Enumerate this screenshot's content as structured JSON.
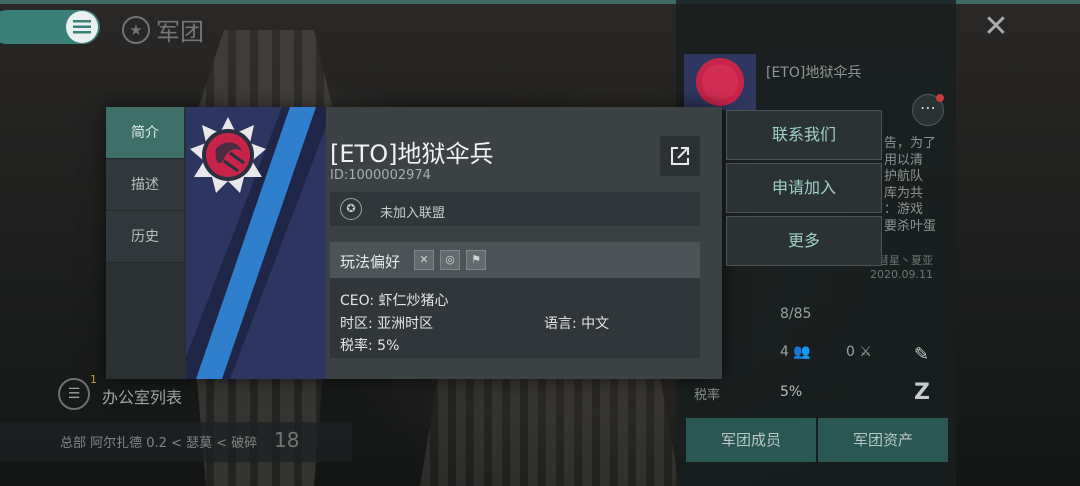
{
  "header": {
    "title": "军团"
  },
  "dialog": {
    "tabs": [
      {
        "label": "简介"
      },
      {
        "label": "描述"
      },
      {
        "label": "历史"
      }
    ],
    "corp_name": "[ETO]地狱伞兵",
    "corp_id": "ID:1000002974",
    "alliance": "未加入联盟",
    "play_pref_label": "玩法偏好",
    "details": {
      "ceo": "CEO: 虾仁炒猪心",
      "timezone": "时区: 亚洲时区",
      "language": "语言: 中文",
      "tax": "税率: 5%"
    }
  },
  "actions": {
    "contact": "联系我们",
    "apply": "申请加入",
    "more": "更多"
  },
  "right_panel": {
    "name": "[ETO]地狱伞兵",
    "desc_lines": [
      "告，为了",
      "用以清",
      "护航队",
      "库为共",
      "：游戏",
      "要杀叶蛋"
    ],
    "date_line1": "彗星丶夏亚",
    "date_line2": "2020.09.11",
    "count": "8/85",
    "members_stat": "4",
    "kills_stat": "0",
    "tax_label": "税率",
    "tax_value": "5%",
    "btn_members": "军团成员",
    "btn_assets": "军团资产"
  },
  "bottom_left": {
    "badge": "1",
    "office_list": "办公室列表",
    "location": "总部 阿尔扎德 0.2 < 瑟莫 < 破碎",
    "location_num": "18"
  },
  "colors": {
    "accent": "#3e7069",
    "banner_blue": "#2f3760",
    "stripe_blue": "#2f7fcc",
    "logo_red": "#c8244a"
  }
}
